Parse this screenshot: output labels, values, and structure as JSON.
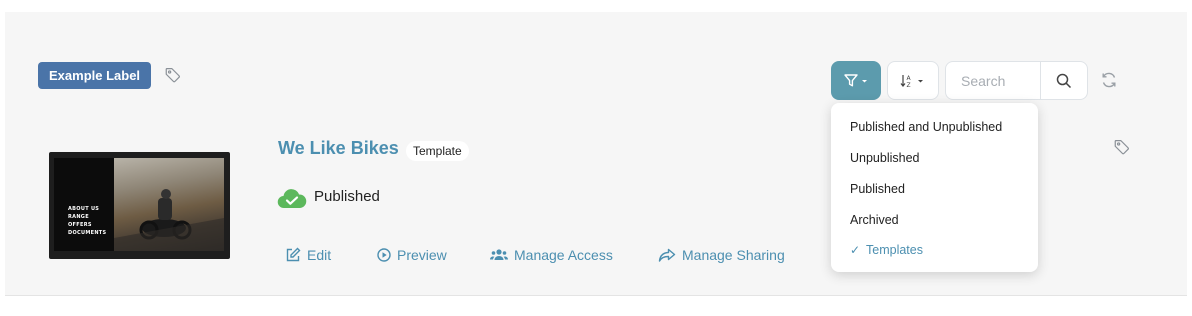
{
  "label": {
    "text": "Example Label"
  },
  "toolbar": {
    "filter_icon": "filter-icon",
    "sort_icon": "sort-icon",
    "search_placeholder": "Search",
    "search_icon": "search-icon",
    "refresh_icon": "refresh-icon"
  },
  "item": {
    "title": "We Like Bikes",
    "badge": "Template",
    "status": "Published",
    "status_icon": "cloud-check-icon",
    "thumbnail_menu": [
      "ABOUT US",
      "RANGE",
      "OFFERS",
      "DOCUMENTS"
    ],
    "actions": {
      "edit": "Edit",
      "preview": "Preview",
      "manage_access": "Manage Access",
      "manage_sharing": "Manage Sharing"
    }
  },
  "filter_menu": {
    "items": [
      {
        "label": "Published and Unpublished",
        "checked": false
      },
      {
        "label": "Unpublished",
        "checked": false
      },
      {
        "label": "Published",
        "checked": false
      },
      {
        "label": "Archived",
        "checked": false
      },
      {
        "label": "Templates",
        "checked": true
      }
    ],
    "check_glyph": "✓"
  },
  "colors": {
    "accent": "#4c8fb0",
    "filter_button": "#5c9bad",
    "label_badge": "#4a74a8",
    "status_green": "#5cb85c"
  }
}
